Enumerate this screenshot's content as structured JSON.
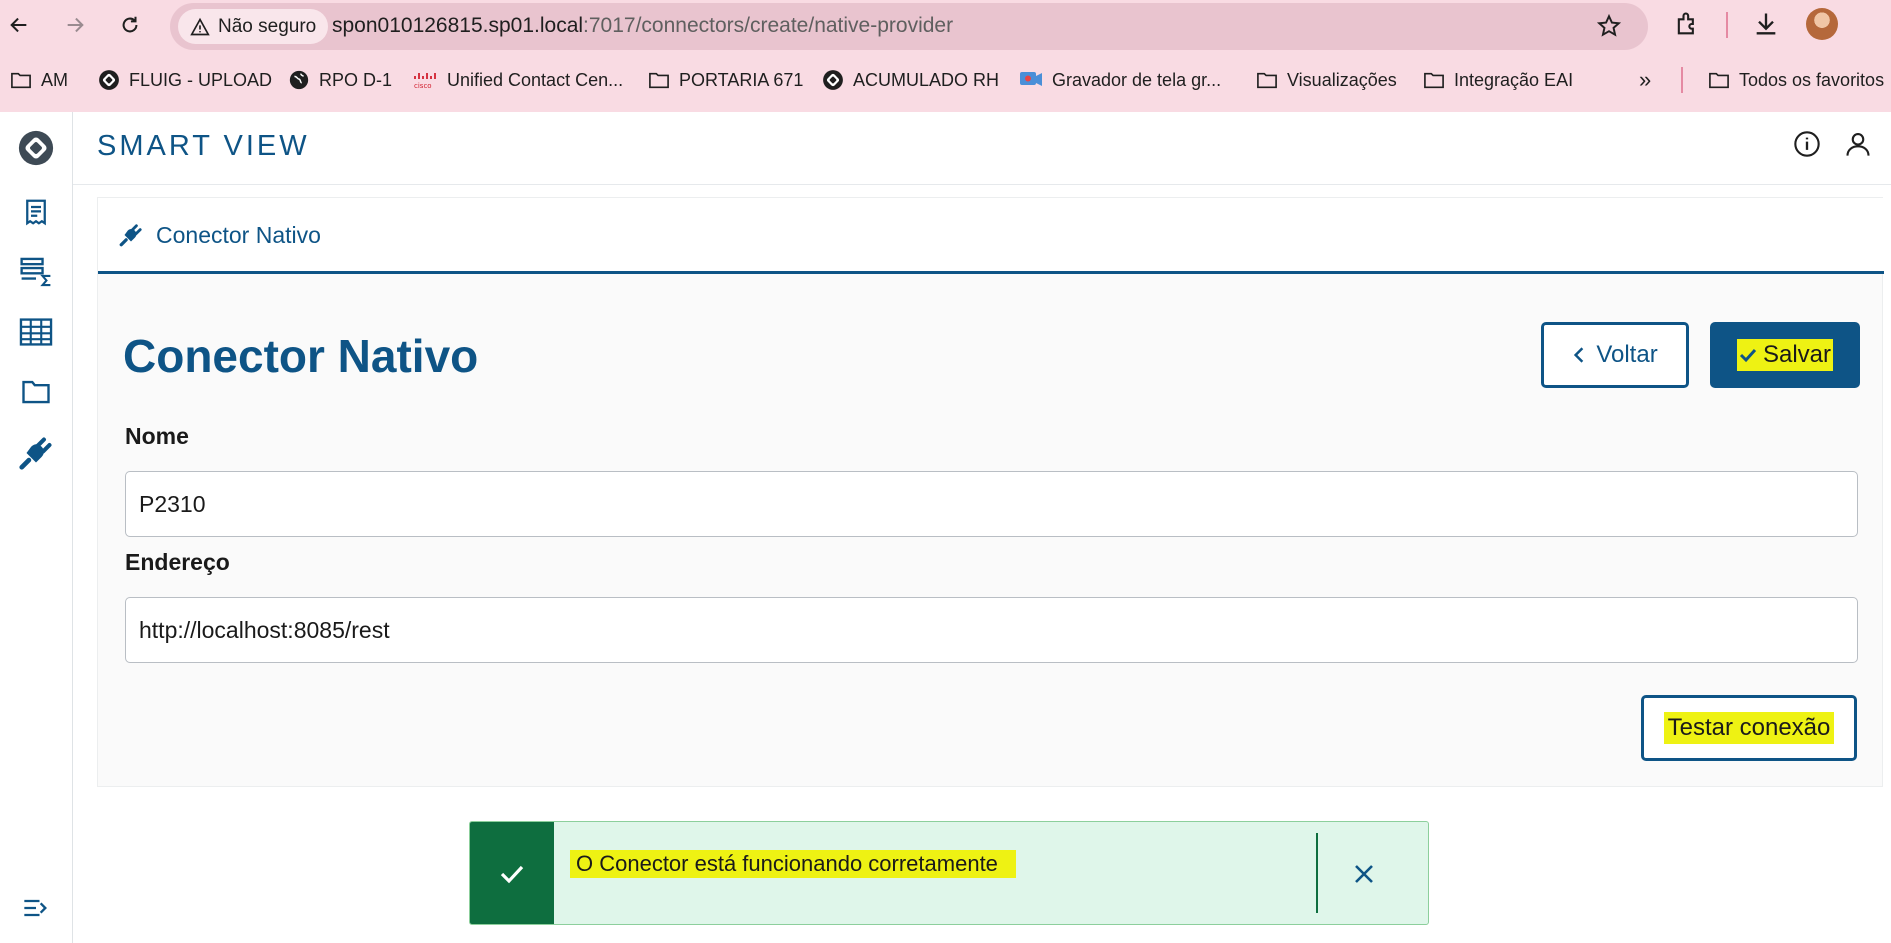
{
  "browser": {
    "security_label": "Não seguro",
    "url_host": "spon010126815.sp01.local",
    "url_path": ":7017/connectors/create/native-provider",
    "bookmarks": [
      {
        "label": "AM",
        "icon": "folder-icon"
      },
      {
        "label": "FLUIG - UPLOAD",
        "icon": "totvs-logo-icon"
      },
      {
        "label": "RPO D-1",
        "icon": "globe-icon"
      },
      {
        "label": "Unified Contact Cen...",
        "icon": "cisco-logo-icon"
      },
      {
        "label": "PORTARIA 671",
        "icon": "folder-icon"
      },
      {
        "label": "ACUMULADO RH",
        "icon": "totvs-logo-icon"
      },
      {
        "label": "Gravador de tela gr...",
        "icon": "screen-recorder-icon"
      },
      {
        "label": "Visualizações",
        "icon": "folder-icon"
      },
      {
        "label": "Integração EAI",
        "icon": "folder-icon"
      }
    ],
    "overflow_label": "»",
    "all_favorites_label": "Todos os favoritos"
  },
  "app": {
    "brand": "SMART VIEW"
  },
  "panel": {
    "breadcrumb": "Conector Nativo",
    "title": "Conector Nativo",
    "back_label": "Voltar",
    "save_label": "Salvar",
    "name_label": "Nome",
    "name_value": "P2310",
    "address_label": "Endereço",
    "address_value": "http://localhost:8085/rest",
    "test_label": "Testar conexão"
  },
  "toast": {
    "message": "O Conector está funcionando corretamente",
    "type": "success"
  },
  "colors": {
    "primary": "#0e5486",
    "success": "#0e6e3f",
    "highlight": "#eef213"
  }
}
